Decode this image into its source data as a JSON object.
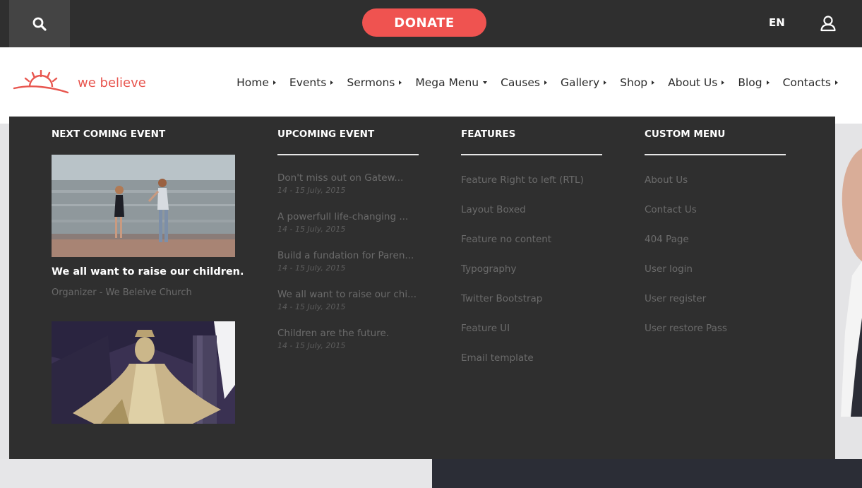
{
  "topbar": {
    "search_icon": "search-icon",
    "donate_label": "DONATE",
    "language": "EN",
    "user_icon": "user-icon",
    "colors": {
      "background": "#2f2f2f",
      "search_bg": "#444444",
      "donate": "#ef5350"
    }
  },
  "header": {
    "logo_text": "we believe",
    "nav": [
      {
        "label": "Home"
      },
      {
        "label": "Events"
      },
      {
        "label": "Sermons"
      },
      {
        "label": "Mega Menu"
      },
      {
        "label": "Causes"
      },
      {
        "label": "Gallery"
      },
      {
        "label": "Shop"
      },
      {
        "label": "About Us"
      },
      {
        "label": "Blog"
      },
      {
        "label": "Contacts"
      }
    ],
    "brand_color": "#e8564f"
  },
  "mega_menu": {
    "next_event": {
      "title": "NEXT COMING EVENT",
      "event_title": "We all want to raise our children.",
      "organizer": "Organizer - We Beleive Church"
    },
    "upcoming": {
      "title": "UPCOMING EVENT",
      "items": [
        {
          "title": "Don't miss out on Gatew...",
          "date": "14 - 15 July, 2015"
        },
        {
          "title": "A powerfull life-changing ...",
          "date": "14 - 15 July, 2015"
        },
        {
          "title": "Build a fundation for Paren...",
          "date": "14 - 15 July, 2015"
        },
        {
          "title": "We all want to raise our chi...",
          "date": "14 - 15 July, 2015"
        },
        {
          "title": "Children are the future.",
          "date": "14 - 15 July, 2015"
        }
      ]
    },
    "features": {
      "title": "FEATURES",
      "items": [
        "Feature Right to left (RTL)",
        "Layout Boxed",
        "Feature no content",
        "Typography",
        "Twitter Bootstrap",
        "Feature UI",
        "Email template"
      ]
    },
    "custom_menu": {
      "title": "CUSTOM MENU",
      "items": [
        "About Us",
        "Contact Us",
        "404 Page",
        "User login",
        "User register",
        "User restore Pass"
      ]
    }
  }
}
